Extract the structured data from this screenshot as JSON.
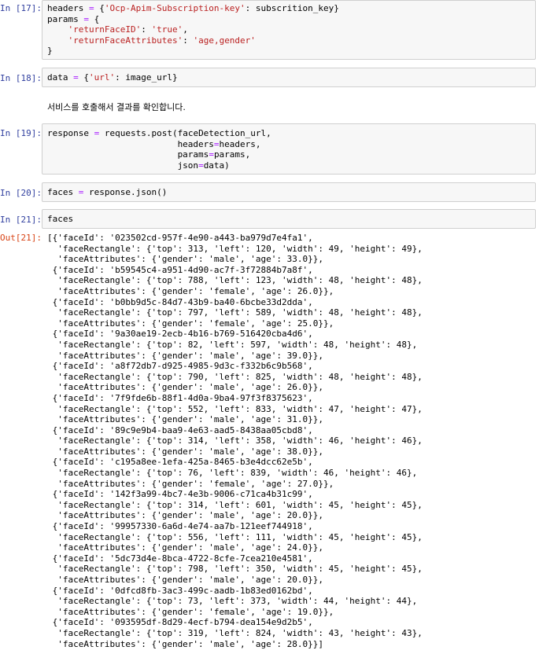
{
  "cells": [
    {
      "prompt": "In [17]:",
      "lines": [
        [
          {
            "t": "headers "
          },
          {
            "t": "=",
            "c": "o"
          },
          {
            "t": " {"
          },
          {
            "t": "'Ocp-Apim-Subscription-key'",
            "c": "s"
          },
          {
            "t": ": subscrition_key}"
          }
        ],
        [
          {
            "t": "params "
          },
          {
            "t": "=",
            "c": "o"
          },
          {
            "t": " {"
          }
        ],
        [
          {
            "t": "    "
          },
          {
            "t": "'returnFaceID'",
            "c": "s"
          },
          {
            "t": ": "
          },
          {
            "t": "'true'",
            "c": "s"
          },
          {
            "t": ","
          }
        ],
        [
          {
            "t": "    "
          },
          {
            "t": "'returnFaceAttributes'",
            "c": "s"
          },
          {
            "t": ": "
          },
          {
            "t": "'age,gender'",
            "c": "s"
          }
        ],
        [
          {
            "t": "}"
          }
        ]
      ]
    },
    {
      "prompt": "In [18]:",
      "lines": [
        [
          {
            "t": "data "
          },
          {
            "t": "=",
            "c": "o"
          },
          {
            "t": " {"
          },
          {
            "t": "'url'",
            "c": "s"
          },
          {
            "t": ": image_url}"
          }
        ]
      ]
    },
    {
      "prompt": "In [19]:",
      "lines": [
        [
          {
            "t": "response "
          },
          {
            "t": "=",
            "c": "o"
          },
          {
            "t": " requests.post(faceDetection_url,"
          }
        ],
        [
          {
            "t": "                         headers"
          },
          {
            "t": "=",
            "c": "o"
          },
          {
            "t": "headers,"
          }
        ],
        [
          {
            "t": "                         params"
          },
          {
            "t": "=",
            "c": "o"
          },
          {
            "t": "params,"
          }
        ],
        [
          {
            "t": "                         json"
          },
          {
            "t": "=",
            "c": "o"
          },
          {
            "t": "data)"
          }
        ]
      ]
    },
    {
      "prompt": "In [20]:",
      "lines": [
        [
          {
            "t": "faces "
          },
          {
            "t": "=",
            "c": "o"
          },
          {
            "t": " response.json()"
          }
        ]
      ]
    },
    {
      "prompt": "In [21]:",
      "lines": [
        [
          {
            "t": "faces"
          }
        ]
      ]
    }
  ],
  "markdown": "서비스를 호출해서 결과를 확인합니다.",
  "output": {
    "prompt": "Out[21]:",
    "lines": [
      "[{'faceId': '023502cd-957f-4e90-a443-ba979d7e4fa1',",
      "  'faceRectangle': {'top': 313, 'left': 120, 'width': 49, 'height': 49},",
      "  'faceAttributes': {'gender': 'male', 'age': 33.0}},",
      " {'faceId': 'b59545c4-a951-4d90-ac7f-3f72884b7a8f',",
      "  'faceRectangle': {'top': 788, 'left': 123, 'width': 48, 'height': 48},",
      "  'faceAttributes': {'gender': 'female', 'age': 26.0}},",
      " {'faceId': 'b0bb9d5c-84d7-43b9-ba40-6bcbe33d2dda',",
      "  'faceRectangle': {'top': 797, 'left': 589, 'width': 48, 'height': 48},",
      "  'faceAttributes': {'gender': 'female', 'age': 25.0}},",
      " {'faceId': '9a30ae19-2ecb-4b16-b769-516420cba4d6',",
      "  'faceRectangle': {'top': 82, 'left': 597, 'width': 48, 'height': 48},",
      "  'faceAttributes': {'gender': 'male', 'age': 39.0}},",
      " {'faceId': 'a8f72db7-d925-4985-9d3c-f332b6c9b568',",
      "  'faceRectangle': {'top': 790, 'left': 825, 'width': 48, 'height': 48},",
      "  'faceAttributes': {'gender': 'male', 'age': 26.0}},",
      " {'faceId': '7f9fde6b-88f1-4d0a-9ba4-97f3f8375623',",
      "  'faceRectangle': {'top': 552, 'left': 833, 'width': 47, 'height': 47},",
      "  'faceAttributes': {'gender': 'male', 'age': 31.0}},",
      " {'faceId': '89c9e9b4-baa9-4e63-aad5-8438aa05cbd8',",
      "  'faceRectangle': {'top': 314, 'left': 358, 'width': 46, 'height': 46},",
      "  'faceAttributes': {'gender': 'male', 'age': 38.0}},",
      " {'faceId': 'c195a8ee-1efa-425a-8465-b3e4dcc62e5b',",
      "  'faceRectangle': {'top': 76, 'left': 839, 'width': 46, 'height': 46},",
      "  'faceAttributes': {'gender': 'female', 'age': 27.0}},",
      " {'faceId': '142f3a99-4bc7-4e3b-9006-c71ca4b31c99',",
      "  'faceRectangle': {'top': 314, 'left': 601, 'width': 45, 'height': 45},",
      "  'faceAttributes': {'gender': 'male', 'age': 20.0}},",
      " {'faceId': '99957330-6a6d-4e74-aa7b-121eef744918',",
      "  'faceRectangle': {'top': 556, 'left': 111, 'width': 45, 'height': 45},",
      "  'faceAttributes': {'gender': 'male', 'age': 24.0}},",
      " {'faceId': '5dc73d4e-8bca-4722-8cfe-7cea210e4581',",
      "  'faceRectangle': {'top': 798, 'left': 350, 'width': 45, 'height': 45},",
      "  'faceAttributes': {'gender': 'male', 'age': 20.0}},",
      " {'faceId': '0dfcd8fb-3ac3-499c-aadb-1b83ed0162bd',",
      "  'faceRectangle': {'top': 73, 'left': 373, 'width': 44, 'height': 44},",
      "  'faceAttributes': {'gender': 'female', 'age': 19.0}},",
      " {'faceId': '093595df-8d29-4ecf-b794-dea154e9d2b5',",
      "  'faceRectangle': {'top': 319, 'left': 824, 'width': 43, 'height': 43},",
      "  'faceAttributes': {'gender': 'male', 'age': 28.0}}]"
    ]
  },
  "colors": {
    "in_prompt": "#303f9f",
    "out_prompt": "#d84315",
    "string": "#ba2121",
    "operator": "#aa22ff",
    "cell_bg": "#f7f7f7",
    "cell_border": "#cfcfcf"
  }
}
